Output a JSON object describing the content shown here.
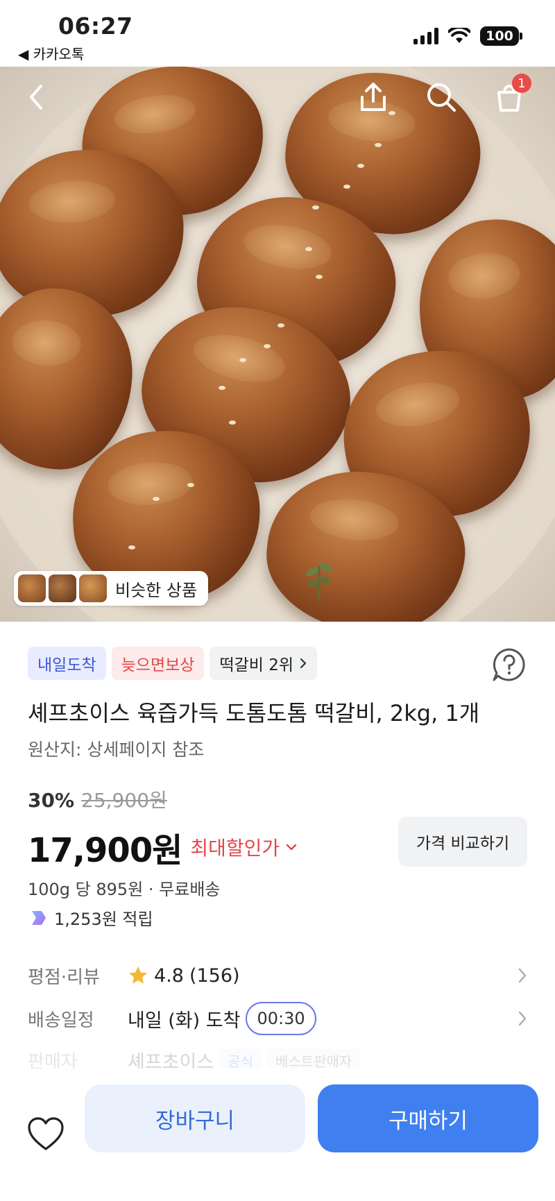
{
  "status_bar": {
    "time": "06:27",
    "back_app": "◀ 카카오톡",
    "battery": "100"
  },
  "header": {
    "cart_badge": "1"
  },
  "hero": {
    "similar_label": "비슷한 상품"
  },
  "product": {
    "tags": {
      "delivery": "내일도착",
      "late_comp": "늦으면보상",
      "rank": "떡갈비 2위"
    },
    "title": "셰프초이스 육즙가득 도톰도톰 떡갈비, 2kg, 1개",
    "origin": "원산지: 상세페이지 참조",
    "discount_pct": "30%",
    "original_price": "25,900원",
    "price": "17,900원",
    "max_discount": "최대할인가",
    "compare_btn": "가격 비교하기",
    "unit_price": "100g 당 895원 · 무료배송",
    "points": "1,253원 적립"
  },
  "rows": {
    "rating_label": "평점·리뷰",
    "rating_value": "4.8",
    "rating_count": "(156)",
    "shipping_label": "배송일정",
    "shipping_value": "내일 (화) 도착",
    "shipping_time": "00:30",
    "seller_label": "판매자",
    "seller_value": "셰프초이스",
    "seller_tag1": "공식",
    "seller_tag2": "베스트판매자"
  },
  "bottom": {
    "cart_label": "장바구니",
    "buy_label": "구매하기"
  },
  "colors": {
    "accent_blue": "#3f7ff0",
    "discount_red": "#e2474a",
    "tag_blue_bg": "#e9ecff",
    "tag_red_bg": "#fdeaea"
  }
}
